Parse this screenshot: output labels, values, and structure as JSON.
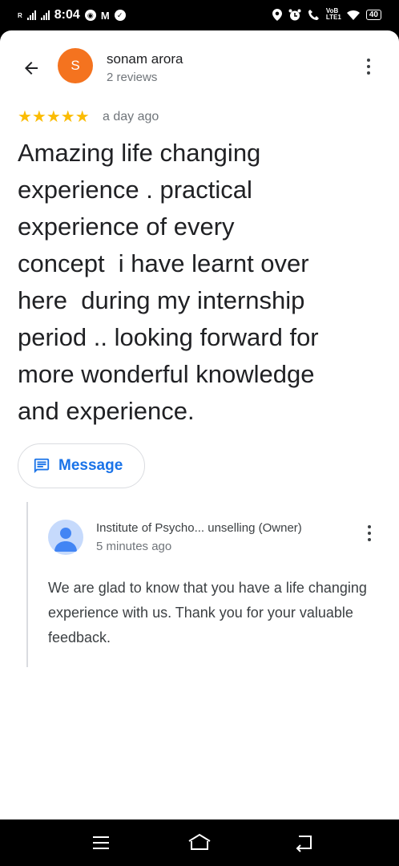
{
  "status_bar": {
    "carrier_mark": "R",
    "time": "8:04",
    "gmail_glyph": "M",
    "volte_label": "VoB LTE1",
    "battery_level": "40"
  },
  "header": {
    "avatar_initial": "S",
    "reviewer_name": "sonam arora",
    "reviewer_subtitle": "2 reviews"
  },
  "review": {
    "rating": 5,
    "stars": "★★★★★",
    "date": "a day ago",
    "text": "Amazing life changing\nexperience . practical\nexperience of every\nconcept  i have learnt over\nhere  during my internship\nperiod .. looking forward for\nmore wonderful knowledge\nand experience."
  },
  "message_button": {
    "label": "Message"
  },
  "owner_reply": {
    "name": "Institute of Psycho... unselling (Owner)",
    "time": "5 minutes ago",
    "text": "We are glad to know that you have a life changing experience with us. Thank you for your valuable feedback."
  },
  "colors": {
    "avatar": "#f4731f",
    "star": "#fbbc04",
    "accent": "#1a73e8",
    "owner_avatar_bg": "#c6dafc",
    "owner_avatar_fg": "#4285f4"
  },
  "icons": {
    "back": "arrow-left-icon",
    "more": "more-vert-icon",
    "message": "message-icon",
    "owner_avatar": "person-icon",
    "nav_menu": "menu-icon",
    "nav_home": "home-icon",
    "nav_back": "return-icon"
  }
}
